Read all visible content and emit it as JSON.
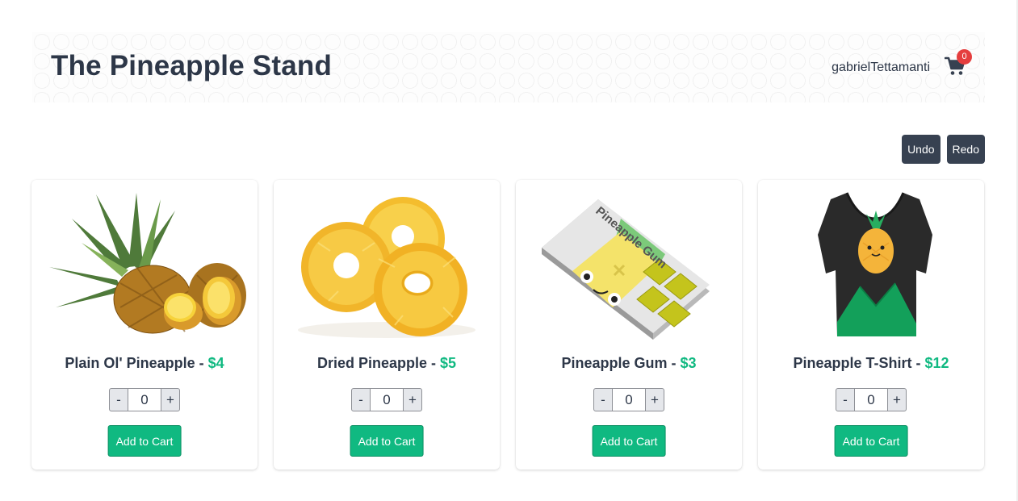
{
  "header": {
    "title": "The Pineapple Stand",
    "username": "gabrielTettamanti",
    "cart_count": "0"
  },
  "history": {
    "undo_label": "Undo",
    "redo_label": "Redo"
  },
  "products": [
    {
      "name": "Plain Ol' Pineapple",
      "separator": " - ",
      "price": "$4",
      "quantity": "0",
      "minus": "-",
      "plus": "+",
      "add_label": "Add to Cart"
    },
    {
      "name": "Dried Pineapple",
      "separator": " - ",
      "price": "$5",
      "quantity": "0",
      "minus": "-",
      "plus": "+",
      "add_label": "Add to Cart"
    },
    {
      "name": "Pineapple Gum",
      "separator": " - ",
      "price": "$3",
      "quantity": "0",
      "minus": "-",
      "plus": "+",
      "add_label": "Add to Cart",
      "package_text": "Pineapple Gum"
    },
    {
      "name": "Pineapple T-Shirt",
      "separator": " - ",
      "price": "$12",
      "quantity": "0",
      "minus": "-",
      "plus": "+",
      "add_label": "Add to Cart"
    }
  ],
  "colors": {
    "accent": "#10b981",
    "dark": "#374151",
    "badge": "#e53e3e",
    "text": "#2d3748"
  },
  "icons": {
    "cart": "shopping-cart-icon"
  }
}
